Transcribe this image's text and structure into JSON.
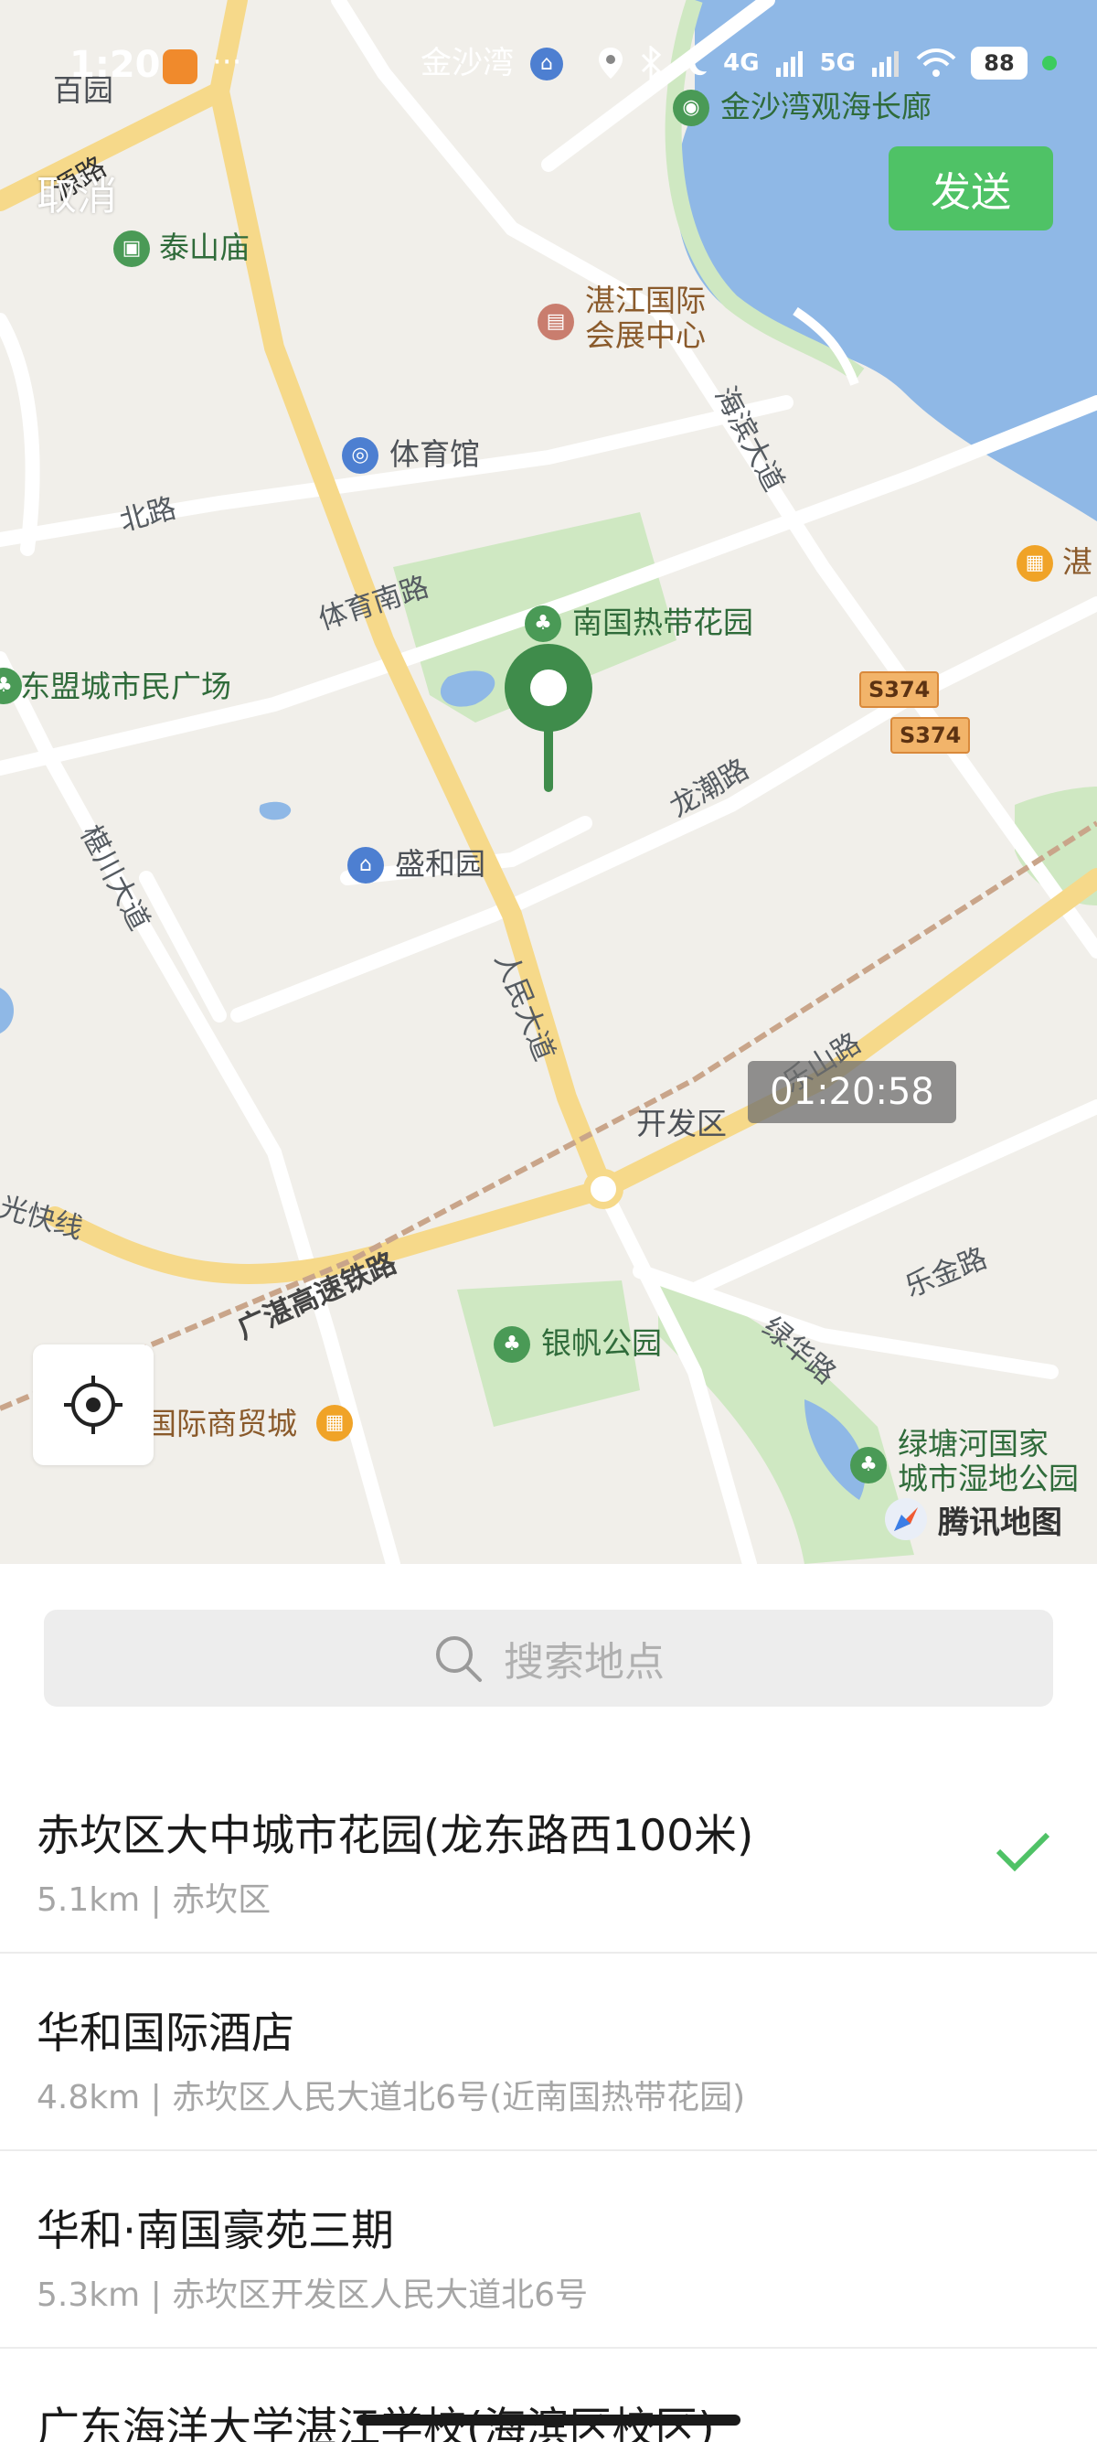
{
  "status_bar": {
    "time": "1:20",
    "more": "···",
    "network_4g": "4G",
    "network_5g": "5G",
    "battery": "88"
  },
  "header": {
    "cancel_label": "取消",
    "send_label": "发送"
  },
  "map": {
    "labels": {
      "jinshawan": "金沙湾",
      "baiyuan": "百园",
      "jinshawan_corridor": "金沙湾观海长廊",
      "taishan_temple": "泰山庙",
      "zhanjiang_expo_1": "湛江国际",
      "zhanjiang_expo_2": "会展中心",
      "stadium": "体育馆",
      "nanguo_garden": "南国热带花园",
      "dongmeng_square": "东盟城市民广场",
      "shenghe_garden": "盛和园",
      "development_zone": "开发区",
      "yinfan_park": "银帆公园",
      "trade_city": "国际商贸城",
      "lvtanghe_1": "绿塘河国家",
      "lvtanghe_2": "城市湿地公园",
      "zhan": "湛"
    },
    "roads": {
      "beilu": "北路",
      "tiyu_nan": "体育南路",
      "haibin": "海滨大道",
      "longchao": "龙潮路",
      "kanchuan": "椹川大道",
      "renmin": "人民大道",
      "leshan": "乐山路",
      "lejin": "乐金路",
      "lvhua": "绿华路",
      "railway": "广湛高速铁路",
      "kuaixian": "光快线",
      "yuanlu": "源路",
      "s374a": "S374",
      "s374b": "S374"
    },
    "timestamp": "01:20:58",
    "brand": "腾讯地图"
  },
  "search": {
    "placeholder": "搜索地点"
  },
  "results": [
    {
      "title": "赤坎区大中城市花园(龙东路西100米)",
      "subtitle": "5.1km | 赤坎区",
      "selected": true
    },
    {
      "title": "华和国际酒店",
      "subtitle": "4.8km | 赤坎区人民大道北6号(近南国热带花园)",
      "selected": false
    },
    {
      "title": "华和·南国豪苑三期",
      "subtitle": "5.3km | 赤坎区开发区人民大道北6号",
      "selected": false
    },
    {
      "title": "广东海洋大学湛江学校(海滨区校区)",
      "subtitle": "",
      "selected": false
    }
  ],
  "colors": {
    "accent_green": "#4fc266",
    "pin_green": "#3f8c4b",
    "water_blue": "#8fb8e6",
    "park_green": "#cfe8c2",
    "main_road": "#f6d98a"
  }
}
